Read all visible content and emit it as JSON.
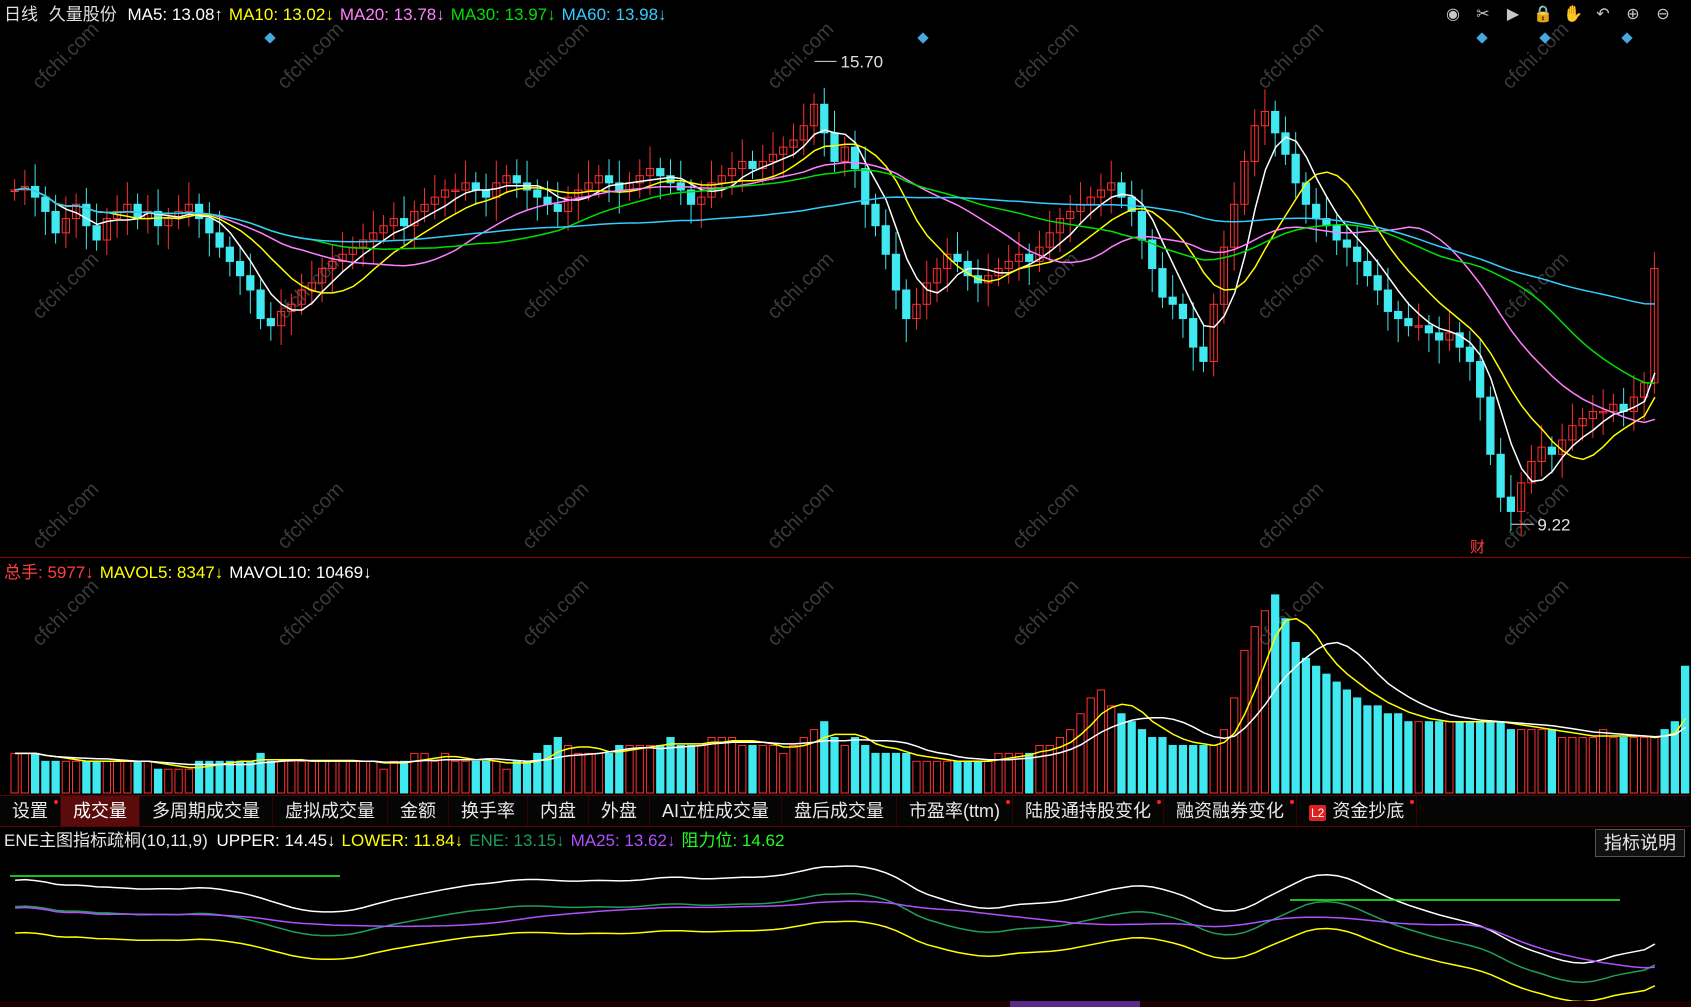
{
  "main": {
    "period": "日线",
    "stock_name": "久量股份",
    "ma": [
      {
        "label": "MA5:",
        "value": "13.08",
        "arrow": "↑",
        "color": "#ffffff"
      },
      {
        "label": "MA10:",
        "value": "13.02",
        "arrow": "↓",
        "color": "#ffff00"
      },
      {
        "label": "MA20:",
        "value": "13.78",
        "arrow": "↓",
        "color": "#ff80ff"
      },
      {
        "label": "MA30:",
        "value": "13.97",
        "arrow": "↓",
        "color": "#00e000"
      },
      {
        "label": "MA60:",
        "value": "13.98",
        "arrow": "↓",
        "color": "#33ccff"
      }
    ],
    "high_label": "15.70",
    "low_label": "9.22",
    "fin_label": "财"
  },
  "volume": {
    "items": [
      {
        "label": "总手:",
        "value": "5977",
        "arrow": "↓",
        "color": "#ff4040"
      },
      {
        "label": "MAVOL5:",
        "value": "8347",
        "arrow": "↓",
        "color": "#ffff00"
      },
      {
        "label": "MAVOL10:",
        "value": "10469",
        "arrow": "↓",
        "color": "#ffffff"
      }
    ]
  },
  "tabs": [
    {
      "label": "设置",
      "active": false,
      "dot": true
    },
    {
      "label": "成交量",
      "active": true,
      "dot": false
    },
    {
      "label": "多周期成交量",
      "active": false,
      "dot": false
    },
    {
      "label": "虚拟成交量",
      "active": false,
      "dot": false
    },
    {
      "label": "金额",
      "active": false,
      "dot": false
    },
    {
      "label": "换手率",
      "active": false,
      "dot": false
    },
    {
      "label": "内盘",
      "active": false,
      "dot": false
    },
    {
      "label": "外盘",
      "active": false,
      "dot": false
    },
    {
      "label": "AI立桩成交量",
      "active": false,
      "dot": false
    },
    {
      "label": "盘后成交量",
      "active": false,
      "dot": false
    },
    {
      "label": "市盈率(ttm)",
      "active": false,
      "dot": true
    },
    {
      "label": "陆股通持股变化",
      "active": false,
      "dot": true
    },
    {
      "label": "融资融券变化",
      "active": false,
      "dot": true
    },
    {
      "label": "资金抄底",
      "active": false,
      "dot": true,
      "badge": "L2"
    }
  ],
  "indicator": {
    "title": "ENE主图指标疏桐(10,11,9)",
    "items": [
      {
        "label": "UPPER:",
        "value": "14.45",
        "arrow": "↓",
        "color": "#ffffff"
      },
      {
        "label": "LOWER:",
        "value": "11.84",
        "arrow": "↓",
        "color": "#ffff00"
      },
      {
        "label": "ENE:",
        "value": "13.15",
        "arrow": "↓",
        "color": "#1e9e5a"
      },
      {
        "label": "MA25:",
        "value": "13.62",
        "arrow": "↓",
        "color": "#b050ff"
      },
      {
        "label": "阻力位:",
        "value": "14.62",
        "arrow": "",
        "color": "#20ff20"
      }
    ],
    "explain_label": "指标说明"
  },
  "toolbar": [
    "eye-icon",
    "scissors-icon",
    "play-icon",
    "lock-icon",
    "hand-icon",
    "undo-icon",
    "zoom-in-icon",
    "zoom-out-icon"
  ],
  "colors": {
    "up": "#ff3030",
    "down": "#40e8f0",
    "watermark": "cfchi.com"
  },
  "chart_data": [
    {
      "type": "candlestick",
      "title": "日线 久量股份",
      "price_range": [
        9.0,
        16.0
      ],
      "annotations": {
        "high": 15.7,
        "low": 9.22
      },
      "closes": [
        13.9,
        13.95,
        13.8,
        13.6,
        13.3,
        13.5,
        13.7,
        13.4,
        13.2,
        13.5,
        13.6,
        13.7,
        13.5,
        13.6,
        13.4,
        13.5,
        13.6,
        13.7,
        13.5,
        13.3,
        13.1,
        12.9,
        12.7,
        12.5,
        12.1,
        12.0,
        12.2,
        12.3,
        12.5,
        12.6,
        12.8,
        12.9,
        13.0,
        13.1,
        13.2,
        13.3,
        13.4,
        13.5,
        13.4,
        13.6,
        13.7,
        13.8,
        13.9,
        13.9,
        14.0,
        13.9,
        13.8,
        14.0,
        14.1,
        14.0,
        13.9,
        13.8,
        13.7,
        13.6,
        13.8,
        13.9,
        14.0,
        14.1,
        14.0,
        13.9,
        14.0,
        14.1,
        14.2,
        14.1,
        14.0,
        13.9,
        13.7,
        13.8,
        14.0,
        14.1,
        14.2,
        14.3,
        14.2,
        14.3,
        14.4,
        14.5,
        14.6,
        14.8,
        15.1,
        14.7,
        14.3,
        14.5,
        14.2,
        13.7,
        13.4,
        13.0,
        12.5,
        12.1,
        12.3,
        12.6,
        12.8,
        13.0,
        12.9,
        12.7,
        12.6,
        12.7,
        12.8,
        12.9,
        13.0,
        12.9,
        13.1,
        13.3,
        13.5,
        13.6,
        13.7,
        13.8,
        13.9,
        14.0,
        13.8,
        13.6,
        13.2,
        12.8,
        12.4,
        12.3,
        12.1,
        11.7,
        11.5,
        12.3,
        13.1,
        13.7,
        14.3,
        14.8,
        15.0,
        14.7,
        14.4,
        14.0,
        13.7,
        13.5,
        13.4,
        13.2,
        13.1,
        12.9,
        12.7,
        12.5,
        12.2,
        12.1,
        12.0,
        12.0,
        11.9,
        11.8,
        11.9,
        11.7,
        11.5,
        11.0,
        10.2,
        9.6,
        9.4,
        9.8,
        10.1,
        10.3,
        10.2,
        10.4,
        10.6,
        10.7,
        10.8,
        10.8,
        10.9,
        10.8,
        11.0,
        11.2,
        12.8
      ],
      "ma": {
        "MA5": 13.08,
        "MA10": 13.02,
        "MA20": 13.78,
        "MA30": 13.97,
        "MA60": 13.98
      }
    },
    {
      "type": "bar",
      "title": "成交量",
      "values": [
        5,
        5,
        5,
        4,
        4,
        4,
        4,
        4,
        4,
        4,
        4,
        4,
        4,
        4,
        3,
        3,
        3,
        3,
        4,
        4,
        4,
        4,
        4,
        4,
        5,
        4,
        4,
        4,
        4,
        4,
        4,
        4,
        4,
        4,
        4,
        4,
        3,
        4,
        4,
        5,
        5,
        4,
        5,
        4,
        4,
        4,
        4,
        4,
        3,
        4,
        4,
        5,
        6,
        7,
        6,
        5,
        5,
        5,
        5,
        6,
        6,
        6,
        6,
        6,
        7,
        6,
        6,
        6,
        7,
        7,
        7,
        6,
        6,
        6,
        6,
        5,
        6,
        7,
        8,
        9,
        7,
        6,
        7,
        6,
        5,
        5,
        5,
        5,
        4,
        4,
        4,
        4,
        4,
        4,
        4,
        4,
        5,
        5,
        5,
        5,
        6,
        6,
        7,
        8,
        10,
        12,
        13,
        11,
        10,
        9,
        8,
        7,
        7,
        6,
        6,
        6,
        6,
        6,
        8,
        12,
        18,
        21,
        23,
        25,
        22,
        19,
        17,
        16,
        15,
        14,
        13,
        12,
        11,
        11,
        10,
        10,
        9,
        9,
        9,
        9,
        9,
        9,
        9,
        9,
        9,
        9,
        8,
        8,
        8,
        8,
        8,
        7,
        7,
        7,
        7,
        8,
        7,
        7,
        7,
        7,
        7,
        8,
        9,
        16
      ],
      "series": [
        {
          "name": "MAVOL5",
          "last": 8347
        },
        {
          "name": "MAVOL10",
          "last": 10469
        }
      ],
      "last": 5977
    },
    {
      "type": "line",
      "title": "ENE主图指标疏桐(10,11,9)",
      "series": [
        {
          "name": "UPPER",
          "last": 14.45
        },
        {
          "name": "LOWER",
          "last": 11.84
        },
        {
          "name": "ENE",
          "last": 13.15
        },
        {
          "name": "MA25",
          "last": 13.62
        },
        {
          "name": "阻力位",
          "last": 14.62
        }
      ]
    }
  ]
}
